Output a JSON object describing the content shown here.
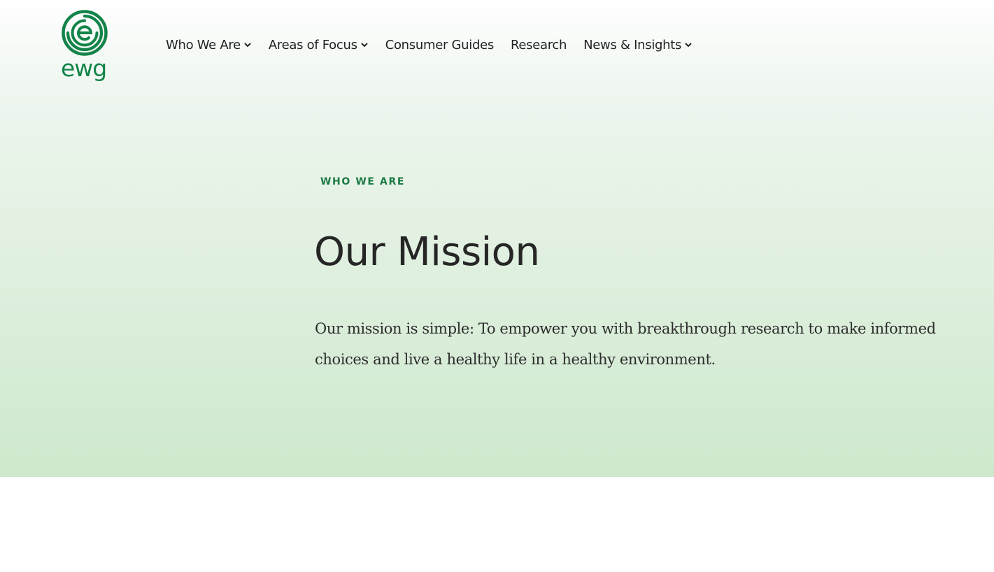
{
  "brand": {
    "logo_text": "ewg",
    "accent_color": "#138449",
    "logo_icon": "ewg-spiral-icon"
  },
  "nav": {
    "items": [
      {
        "label": "Who We Are",
        "has_dropdown": true
      },
      {
        "label": "Areas of Focus",
        "has_dropdown": true
      },
      {
        "label": "Consumer Guides",
        "has_dropdown": false
      },
      {
        "label": "Research",
        "has_dropdown": false
      },
      {
        "label": "News & Insights",
        "has_dropdown": true
      }
    ]
  },
  "hero": {
    "eyebrow": "WHO WE ARE",
    "title": "Our Mission",
    "body": "Our mission is simple: To empower you with breakthrough research to make informed choices and live a healthy life in a healthy environment."
  }
}
